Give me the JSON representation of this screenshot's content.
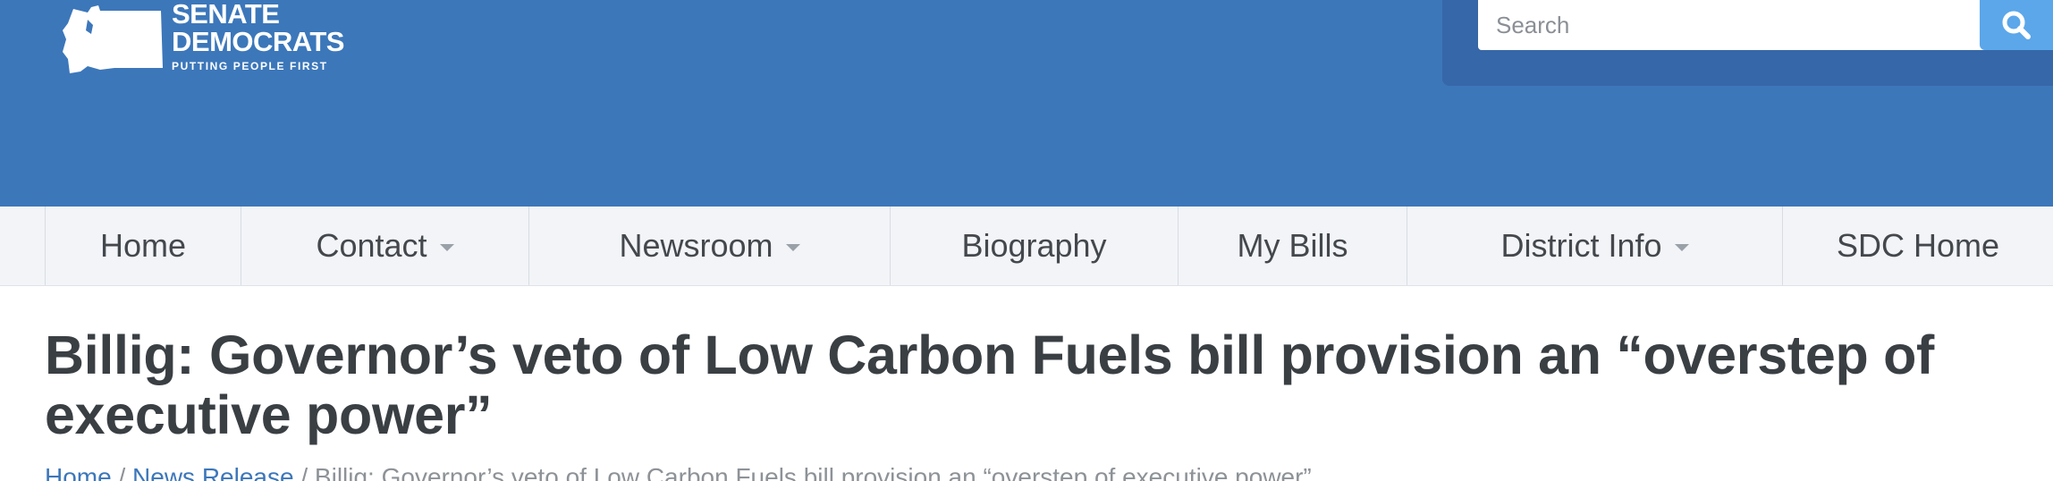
{
  "logo": {
    "line1": "SENATE",
    "line2": "DEMOCRATS",
    "tagline": "PUTTING PEOPLE FIRST",
    "icon": "washington-state-icon"
  },
  "search": {
    "placeholder": "Search",
    "button_icon": "search-icon"
  },
  "nav": {
    "items": [
      {
        "label": "Home",
        "dropdown": false
      },
      {
        "label": "Contact",
        "dropdown": true
      },
      {
        "label": "Newsroom",
        "dropdown": true
      },
      {
        "label": "Biography",
        "dropdown": false
      },
      {
        "label": "My Bills",
        "dropdown": false
      },
      {
        "label": "District Info",
        "dropdown": true
      },
      {
        "label": "SDC Home",
        "dropdown": false
      }
    ]
  },
  "article": {
    "title": "Billig: Governor’s veto of Low Carbon Fuels bill provision an “overstep of executive power”"
  },
  "breadcrumb": {
    "home": "Home",
    "sep1": " / ",
    "section": "News Release",
    "sep2": " / ",
    "current": "Billig: Governor’s veto of Low Carbon Fuels bill provision an “overstep of executive power”"
  },
  "colors": {
    "header": "#3c77ba",
    "search_panel": "#3667a8",
    "search_button": "#5ba7ea",
    "nav_bg": "#f2f4f8",
    "title_text": "#3a3f44",
    "link": "#3c77ba"
  }
}
